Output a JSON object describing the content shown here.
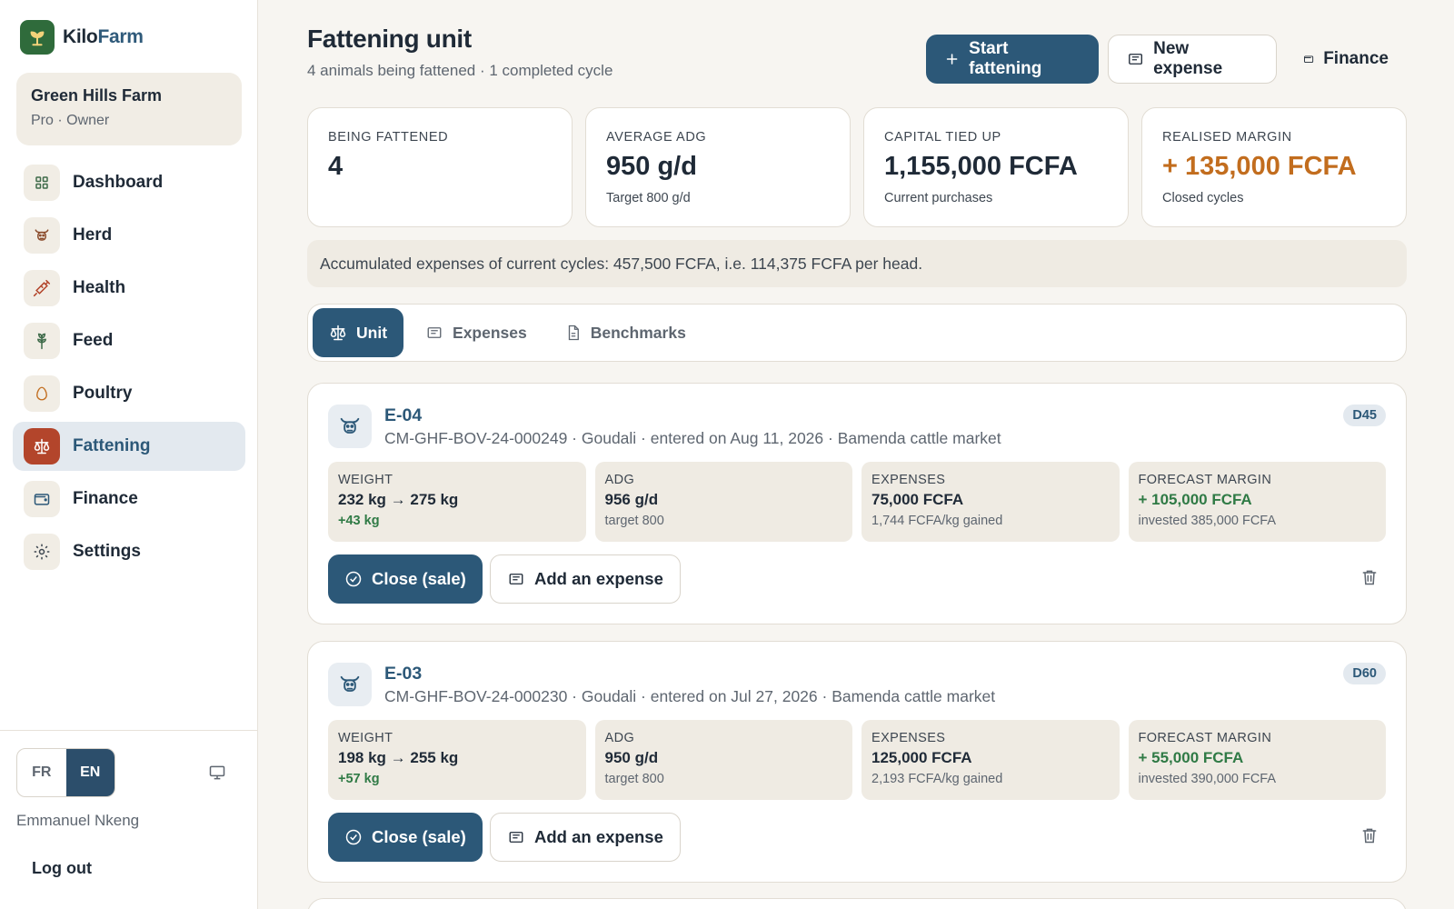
{
  "brand": {
    "name_part1": "Kilo",
    "name_part2": "Farm",
    "logo_icon": "sprout-icon"
  },
  "farm": {
    "name": "Green Hills Farm",
    "subtitle": "Pro · Owner"
  },
  "nav": {
    "items": [
      {
        "label": "Dashboard",
        "icon": "grid-icon"
      },
      {
        "label": "Herd",
        "icon": "cow-icon"
      },
      {
        "label": "Health",
        "icon": "syringe-icon"
      },
      {
        "label": "Feed",
        "icon": "wheat-icon"
      },
      {
        "label": "Poultry",
        "icon": "egg-icon"
      },
      {
        "label": "Fattening",
        "icon": "scale-icon",
        "active": true
      },
      {
        "label": "Finance",
        "icon": "wallet-icon"
      },
      {
        "label": "Settings",
        "icon": "gear-icon"
      }
    ]
  },
  "lang": {
    "fr": "FR",
    "en": "EN",
    "active": "EN"
  },
  "user": {
    "name": "Emmanuel Nkeng",
    "logout": "Log out"
  },
  "header": {
    "title": "Fattening unit",
    "subtitle": "4 animals being fattened · 1 completed cycle",
    "start_button": "Start fattening",
    "expense_button": "New expense",
    "finance_button": "Finance"
  },
  "kpis": [
    {
      "label": "Being fattened",
      "value": "4",
      "note": ""
    },
    {
      "label": "Average ADG",
      "value": "950 g/d",
      "note": "Target 800 g/d"
    },
    {
      "label": "Capital tied up",
      "value": "1,155,000 FCFA",
      "note": "Current purchases"
    },
    {
      "label": "Realised margin",
      "value": "+ 135,000 FCFA",
      "note": "Closed cycles"
    }
  ],
  "banner": "Accumulated expenses of current cycles: 457,500 FCFA, i.e. 114,375 FCFA per head.",
  "tabs": [
    {
      "label": "Unit",
      "icon": "scale-icon",
      "active": true
    },
    {
      "label": "Expenses",
      "icon": "receipt-icon"
    },
    {
      "label": "Benchmarks",
      "icon": "document-icon"
    }
  ],
  "animals": [
    {
      "id": "E-04",
      "meta": "CM-GHF-BOV-24-000249 · Goudali · entered on Aug 11, 2026 · Bamenda cattle market",
      "badge": "D45",
      "weight_label": "Weight",
      "weight_value": "232 kg → 275 kg",
      "weight_gain": "+43 kg",
      "adg_label": "ADG",
      "adg_value": "956 g/d",
      "adg_note": "target 800",
      "expenses_label": "Expenses",
      "expenses_value": "75,000 FCFA",
      "expenses_note": "1,744 FCFA/kg gained",
      "margin_label": "Forecast margin",
      "margin_value": "+ 105,000 FCFA",
      "margin_note": "invested 385,000 FCFA",
      "close_label": "Close (sale)",
      "add_expense_label": "Add an expense"
    },
    {
      "id": "E-03",
      "meta": "CM-GHF-BOV-24-000230 · Goudali · entered on Jul 27, 2026 · Bamenda cattle market",
      "badge": "D60",
      "weight_label": "Weight",
      "weight_value": "198 kg → 255 kg",
      "weight_gain": "+57 kg",
      "adg_label": "ADG",
      "adg_value": "950 g/d",
      "adg_note": "target 800",
      "expenses_label": "Expenses",
      "expenses_value": "125,000 FCFA",
      "expenses_note": "2,193 FCFA/kg gained",
      "margin_label": "Forecast margin",
      "margin_value": "+ 55,000 FCFA",
      "margin_note": "invested 390,000 FCFA",
      "close_label": "Close (sale)",
      "add_expense_label": "Add an expense"
    }
  ],
  "colors": {
    "primary": "#2c5878",
    "accent_red": "#b3452b",
    "margin_green": "#2f7a45",
    "realised_orange": "#c26d1e"
  }
}
